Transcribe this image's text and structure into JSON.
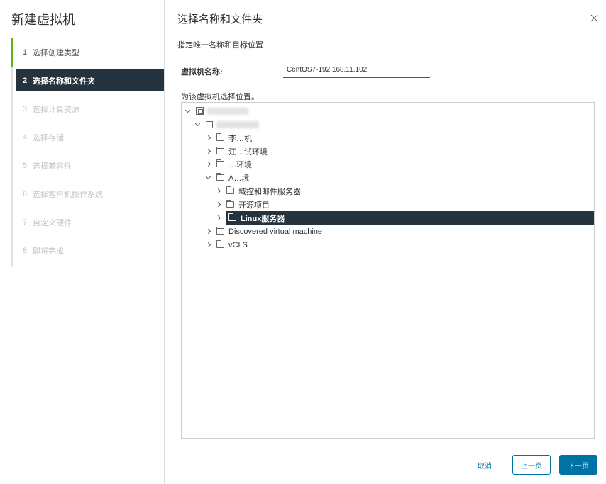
{
  "sidebar": {
    "title": "新建虚拟机",
    "steps": [
      {
        "num": "1",
        "label": "选择创建类型",
        "state": "done"
      },
      {
        "num": "2",
        "label": "选择名称和文件夹",
        "state": "active"
      },
      {
        "num": "3",
        "label": "选择计算资源",
        "state": "disabled"
      },
      {
        "num": "4",
        "label": "选择存储",
        "state": "disabled"
      },
      {
        "num": "5",
        "label": "选择兼容性",
        "state": "disabled"
      },
      {
        "num": "6",
        "label": "选择客户机操作系统",
        "state": "disabled"
      },
      {
        "num": "7",
        "label": "自定义硬件",
        "state": "disabled"
      },
      {
        "num": "8",
        "label": "即将完成",
        "state": "disabled"
      }
    ]
  },
  "main": {
    "title": "选择名称和文件夹",
    "subtitle": "指定唯一名称和目标位置",
    "name_label": "虚拟机名称:",
    "name_value": "CentOS7-192.168.11.102",
    "location_label": "为该虚拟机选择位置。",
    "tree": {
      "root_label": "",
      "datacenter_label": "",
      "folders": [
        {
          "label": "李…机",
          "level": 2,
          "expanded": false
        },
        {
          "label": "江…试环境",
          "level": 2,
          "expanded": false
        },
        {
          "label": "…环境",
          "level": 2,
          "expanded": false
        },
        {
          "label": "A…境",
          "level": 2,
          "expanded": true
        },
        {
          "label": "域控和邮件服务器",
          "level": 3,
          "expanded": false
        },
        {
          "label": "开源项目",
          "level": 3,
          "expanded": false
        },
        {
          "label": "Linux服务器",
          "level": 3,
          "expanded": false,
          "selected": true
        },
        {
          "label": "Discovered virtual machine",
          "level": 2,
          "expanded": false
        },
        {
          "label": "vCLS",
          "level": 2,
          "expanded": false
        }
      ]
    }
  },
  "footer": {
    "cancel_label": "取消",
    "back_label": "上一页",
    "next_label": "下一页"
  },
  "colors": {
    "accent": "#0072a3",
    "active_step_bg": "#25333e",
    "done_step_bar": "#60b515"
  }
}
